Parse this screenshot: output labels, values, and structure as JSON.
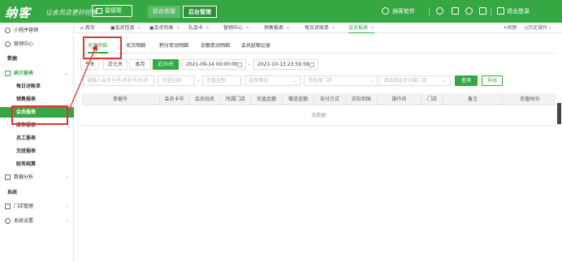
{
  "topbar": {
    "logo": "纳客",
    "slogan": "让会员店更好经营",
    "scan_label": "雷德帮",
    "nav_front": "前台收银",
    "nav_back": "后台管理",
    "user_name": "纳客软件",
    "logout_label": "退出登录"
  },
  "sidebar": {
    "items": [
      {
        "label": "小程序营销"
      },
      {
        "label": "营销中心"
      },
      {
        "label": "数据"
      },
      {
        "label": "统计报表"
      },
      {
        "label": "每日对账单"
      },
      {
        "label": "销售报表"
      },
      {
        "label": "会员报表"
      },
      {
        "label": "库存报表"
      },
      {
        "label": "员工报表"
      },
      {
        "label": "交班报表"
      },
      {
        "label": "财务结算"
      },
      {
        "label": "数据分析"
      },
      {
        "label": "系统"
      },
      {
        "label": "门店管理"
      },
      {
        "label": "系统设置"
      }
    ]
  },
  "page_tabs": [
    {
      "label": "首页"
    },
    {
      "label": "会员信息"
    },
    {
      "label": "会员列表"
    },
    {
      "label": "礼品卡"
    },
    {
      "label": "营销中心"
    },
    {
      "label": "销售报表"
    },
    {
      "label": "每日对账单"
    },
    {
      "label": "会员报表"
    }
  ],
  "tabs_right": {
    "refresh": "刷新",
    "history": "历史操作"
  },
  "sub_tabs": [
    {
      "label": "充值明细"
    },
    {
      "label": "充次明细"
    },
    {
      "label": "积分变动明细"
    },
    {
      "label": "余额变动明细"
    },
    {
      "label": "会员延期记录"
    }
  ],
  "quick_range": [
    "今天",
    "近七天",
    "本月",
    "近30天"
  ],
  "date_start": "2021-09-14 00:00:00",
  "date_end": "2021-10-13 23:59:59",
  "filters": {
    "member_placeholder": "请输入会员卡号/手机号/姓名",
    "amount_min_placeholder": "充值金额",
    "amount_max_placeholder": "充值金额",
    "level_placeholder": "选择等级",
    "store_placeholder": "请选择门店",
    "member_store_placeholder": "请选择会员归属门店",
    "search_label": "查询",
    "export_label": "导出"
  },
  "table": {
    "columns": [
      "单据号",
      "会员卡号",
      "会员姓名",
      "所属门店",
      "充值金额",
      "赠送金额",
      "支付方式",
      "实际到账",
      "操作员",
      "门店",
      "备注",
      "充值时间"
    ],
    "empty_text": "无数据"
  },
  "colors": {
    "brand": "#35a843",
    "highlight": "#e03232"
  }
}
